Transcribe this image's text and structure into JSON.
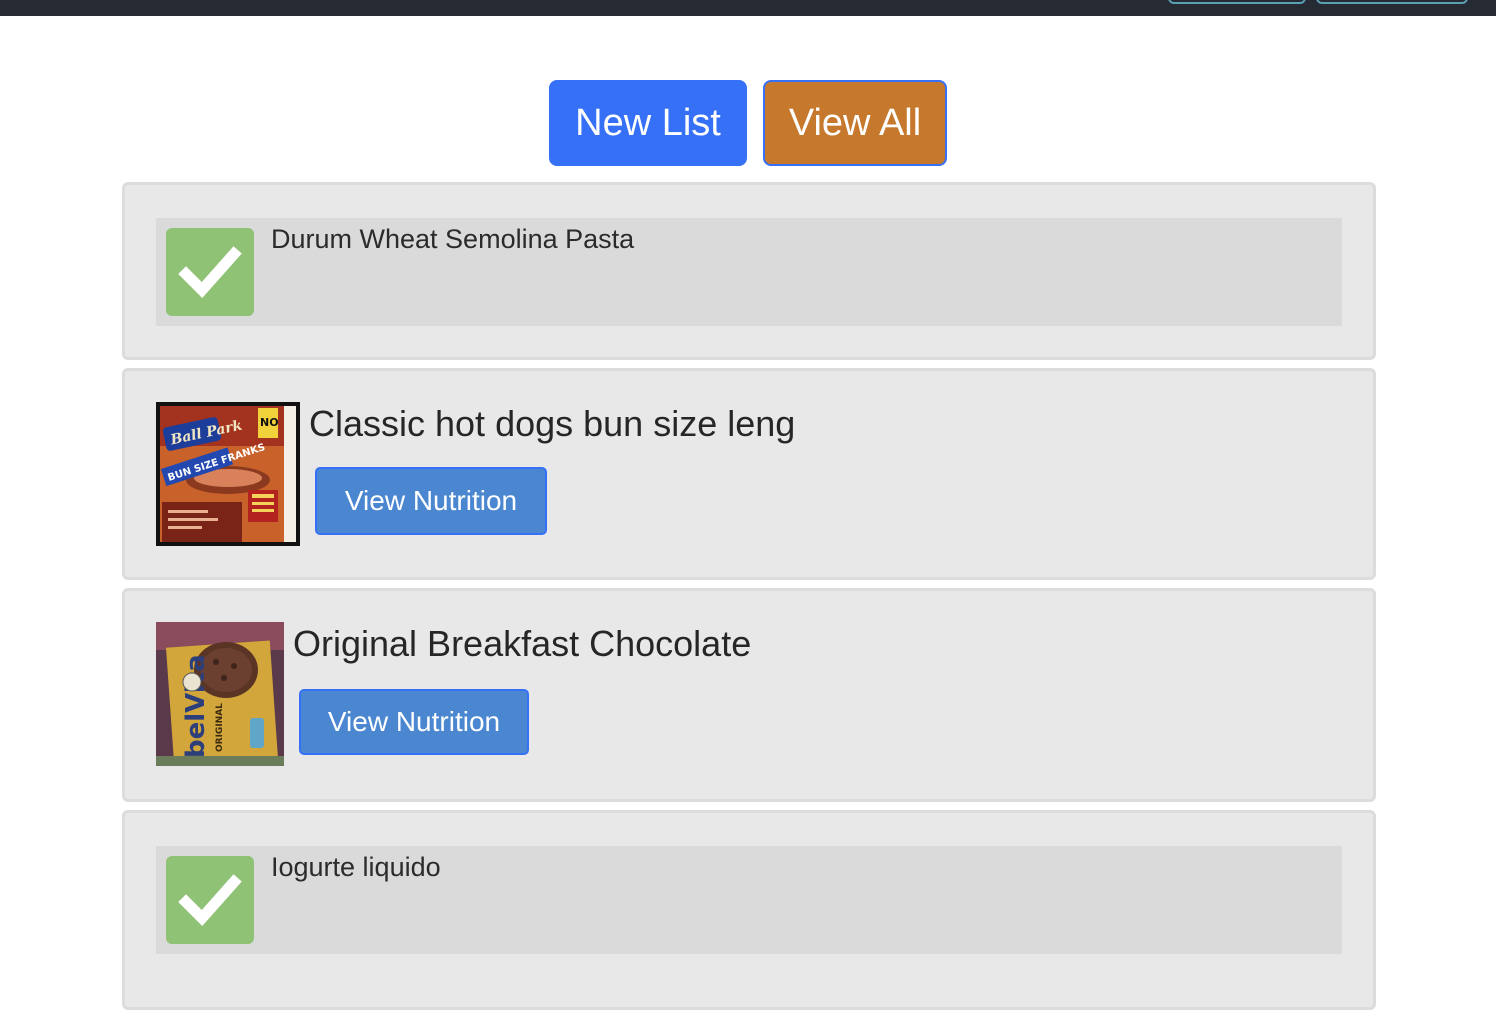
{
  "actions": {
    "new_list": "New List",
    "view_all": "View All"
  },
  "items": [
    {
      "type": "checked",
      "name": "Durum Wheat Semolina Pasta",
      "icon": "checkmark-icon"
    },
    {
      "type": "product",
      "name": "Classic hot dogs bun size leng",
      "image": "ballpark-hot-dogs-package",
      "button": "View Nutrition"
    },
    {
      "type": "product",
      "name": "Original Breakfast Chocolate",
      "image": "belvita-breakfast-biscuits-package",
      "button": "View Nutrition"
    },
    {
      "type": "checked",
      "name": "Iogurte liquido",
      "icon": "checkmark-icon"
    }
  ],
  "colors": {
    "topbar": "#262a33",
    "new_list_button": "#3670f6",
    "view_all_button": "#c6782c",
    "nutrition_button": "#4a87d0",
    "check_box": "#8fc275",
    "card_background": "#e8e8e8"
  }
}
